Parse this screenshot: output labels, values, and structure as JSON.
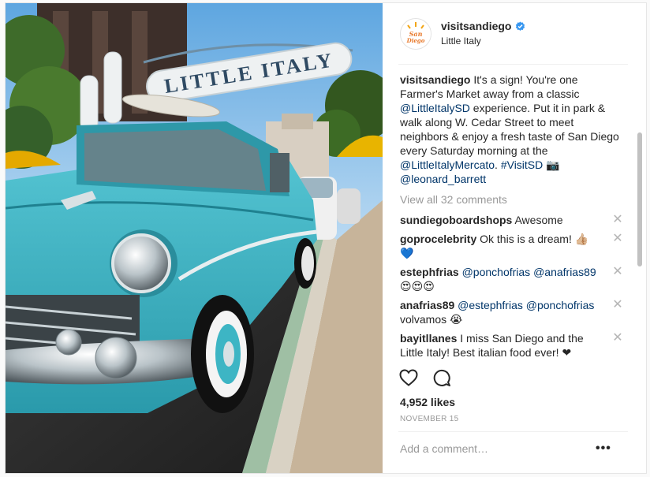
{
  "post": {
    "username": "visitsandiego",
    "location": "Little Italy",
    "avatar_logo_text": "San Diego",
    "sign_text": "LITTLE ITALY",
    "caption": {
      "username": "visitsandiego",
      "text1": " It's a sign! You're one Farmer's Market away from a classic ",
      "mention1": "@LittleItalySD",
      "text2": " experience. Put it in park & walk along W. Cedar Street to meet neighbors & enjoy a fresh taste of San Diego every Saturday morning at the ",
      "mention2": "@LittleItalyMercato",
      "text3": ". ",
      "hashtag": "#VisitSD",
      "camera_emoji": " 📷 ",
      "mention3": "@leonard_barrett"
    },
    "view_all_comments": "View all 32 comments",
    "comments": [
      {
        "user": "sundiegoboardshops",
        "parts": [
          {
            "t": " Awesome",
            "link": false
          }
        ]
      },
      {
        "user": "goprocelebrity",
        "parts": [
          {
            "t": " Ok this is a dream! 👍🏼 💙",
            "link": false
          }
        ]
      },
      {
        "user": "estephfrias",
        "parts": [
          {
            "t": " ",
            "link": false
          },
          {
            "t": "@ponchofrias",
            "link": true
          },
          {
            "t": " ",
            "link": false
          },
          {
            "t": "@anafrias89",
            "link": true
          },
          {
            "t": " 😍😍😍",
            "link": false
          }
        ]
      },
      {
        "user": "anafrias89",
        "parts": [
          {
            "t": " ",
            "link": false
          },
          {
            "t": "@estephfrias",
            "link": true
          },
          {
            "t": " ",
            "link": false
          },
          {
            "t": "@ponchofrias",
            "link": true
          },
          {
            "t": " volvamos 😭",
            "link": false
          }
        ]
      },
      {
        "user": "bayitllanes",
        "parts": [
          {
            "t": " I miss San Diego and the Little Italy! Best italian food ever! ❤",
            "link": false
          }
        ]
      }
    ],
    "close_glyph": "✕",
    "likes": "4,952 likes",
    "date": "NOVEMBER 15",
    "add_comment_placeholder": "Add a comment…",
    "more_glyph": "•••"
  },
  "icons": {
    "like": "heart-outline-icon",
    "comment": "speech-bubble-icon",
    "verified": "verified-badge-icon",
    "more": "ellipsis-icon"
  },
  "colors": {
    "link": "#003569",
    "muted": "#999999",
    "verified": "#3897f0",
    "car_teal": "#3db5c4",
    "sky": "#7db8e6"
  }
}
